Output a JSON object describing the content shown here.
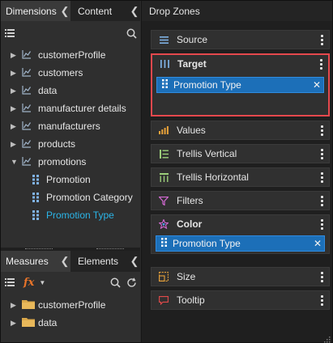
{
  "left_top": {
    "tabs": [
      {
        "label": "Dimensions",
        "active": true
      },
      {
        "label": "Content",
        "active": false
      }
    ],
    "tree": [
      {
        "label": "customerProfile",
        "expanded": false
      },
      {
        "label": "customers",
        "expanded": false
      },
      {
        "label": "data",
        "expanded": false
      },
      {
        "label": "manufacturer details",
        "expanded": false
      },
      {
        "label": "manufacturers",
        "expanded": false
      },
      {
        "label": "products",
        "expanded": false
      },
      {
        "label": "promotions",
        "expanded": true
      }
    ],
    "leaves": [
      {
        "label": "Promotion",
        "selected": false
      },
      {
        "label": "Promotion Category",
        "selected": false
      },
      {
        "label": "Promotion Type",
        "selected": true
      }
    ]
  },
  "left_bottom": {
    "tabs": [
      {
        "label": "Measures",
        "active": true
      },
      {
        "label": "Elements",
        "active": false
      }
    ],
    "fx_label": "fx",
    "folders": [
      {
        "label": "customerProfile"
      },
      {
        "label": "data"
      }
    ]
  },
  "drop_zones": {
    "title": "Drop Zones",
    "zones": [
      {
        "label": "Source",
        "icon": "source-icon"
      },
      {
        "label": "Target",
        "icon": "target-icon",
        "pill": "Promotion Type"
      },
      {
        "label": "Values",
        "icon": "values-icon"
      },
      {
        "label": "Trellis Vertical",
        "icon": "trellis-vertical-icon"
      },
      {
        "label": "Trellis Horizontal",
        "icon": "trellis-horizontal-icon"
      },
      {
        "label": "Filters",
        "icon": "filter-icon"
      },
      {
        "label": "Color",
        "icon": "color-icon",
        "pill": "Promotion Type"
      },
      {
        "label": "Size",
        "icon": "size-icon"
      },
      {
        "label": "Tooltip",
        "icon": "tooltip-icon"
      }
    ]
  },
  "colors": {
    "accent_blue": "#1c6fb8",
    "selected_text": "#2bb5e8",
    "highlight_red": "#e5484d",
    "fx_orange": "#e8742a"
  }
}
